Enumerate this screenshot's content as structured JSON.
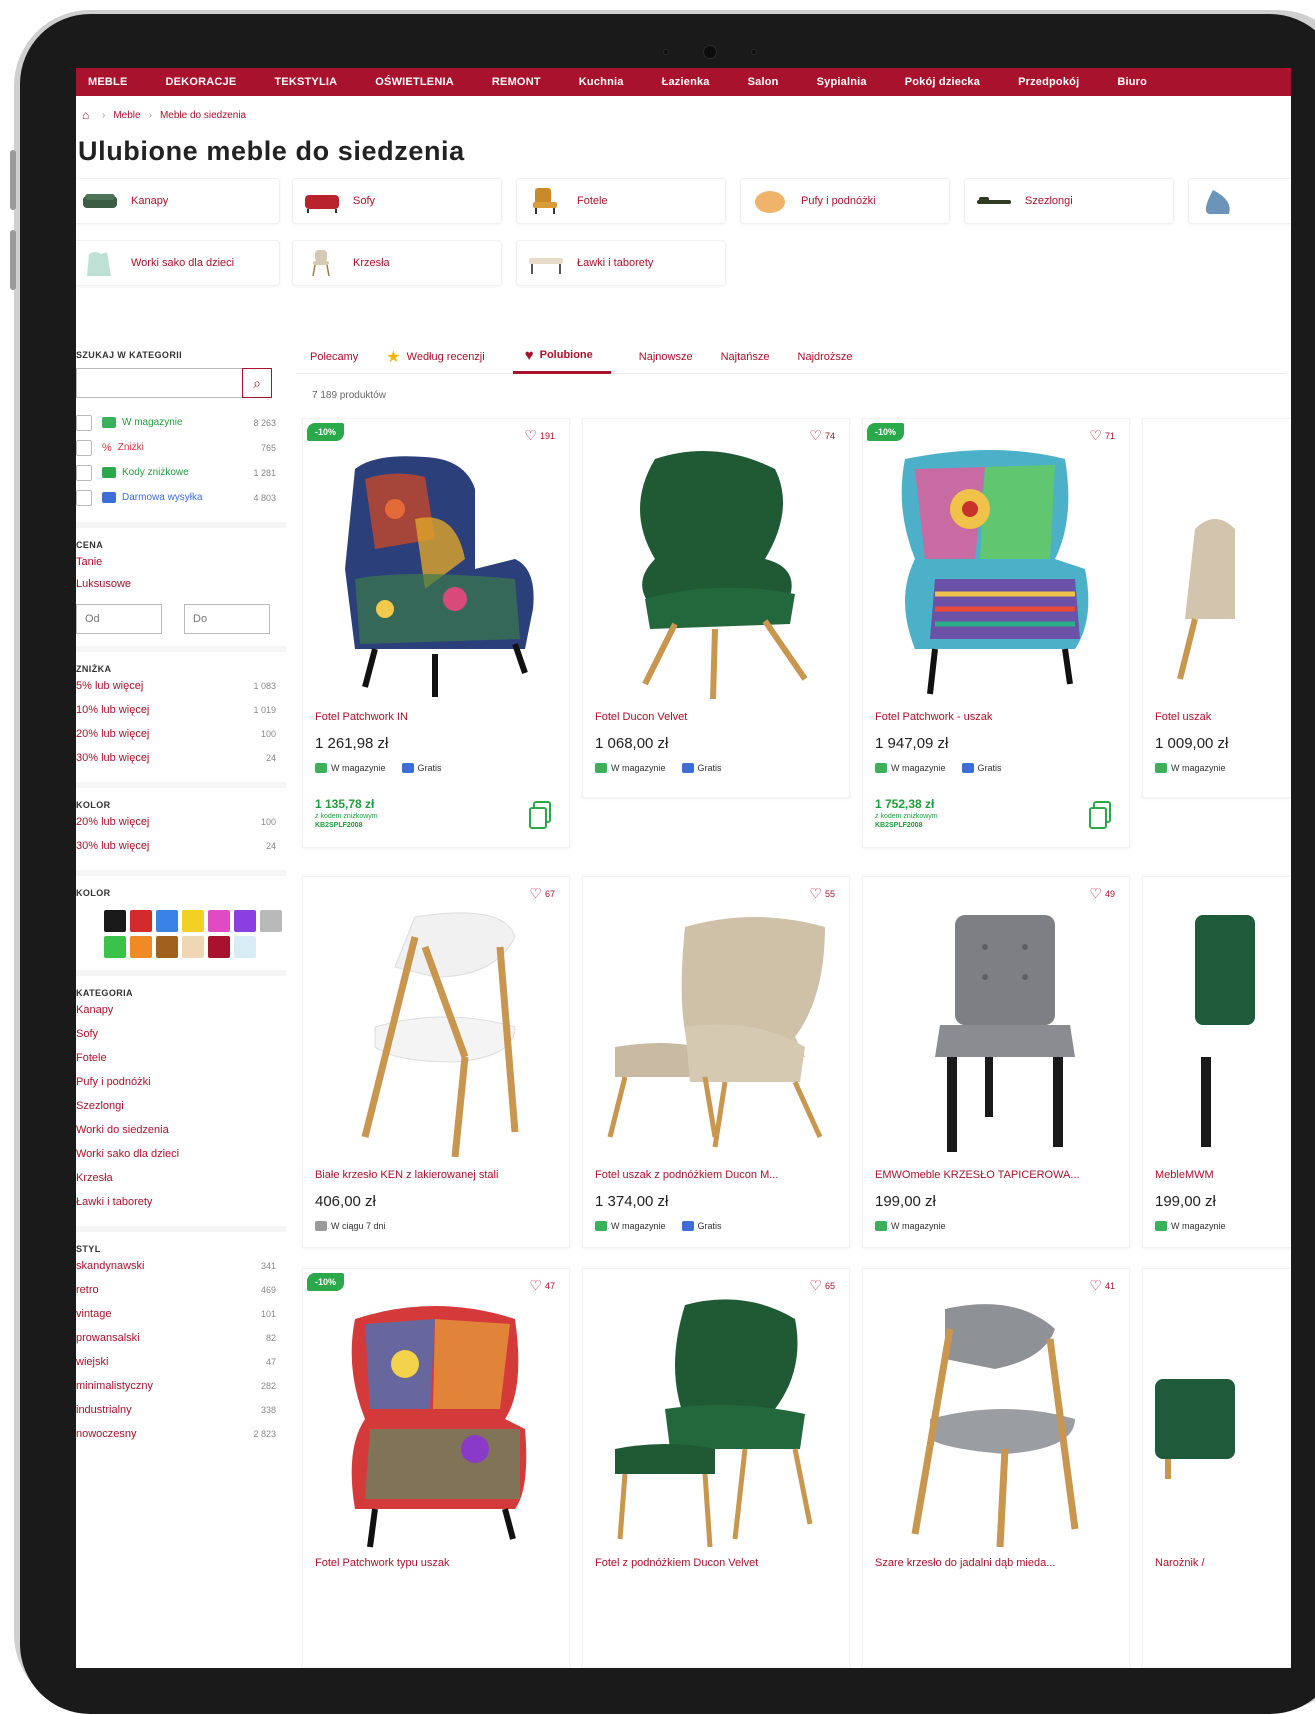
{
  "topnav": [
    "MEBLE",
    "DEKORACJE",
    "TEKSTYLIA",
    "OŚWIETLENIA",
    "REMONT",
    "Kuchnia",
    "Łazienka",
    "Salon",
    "Sypialnia",
    "Pokój dziecka",
    "Przedpokój",
    "Biuro"
  ],
  "breadcrumb": [
    "Meble",
    "Meble do siedzenia"
  ],
  "page_title": "Ulubione meble do siedzenia",
  "categories": [
    {
      "label": "Kanapy"
    },
    {
      "label": "Sofy"
    },
    {
      "label": "Fotele"
    },
    {
      "label": "Pufy i podnóżki"
    },
    {
      "label": "Szezlongi"
    },
    {
      "label": "Worki sako dla dzieci"
    },
    {
      "label": "Krzesła"
    },
    {
      "label": "Ławki i taborety"
    }
  ],
  "sidebar": {
    "search_label": "SZUKAJ W KATEGORII",
    "filters": [
      {
        "label": "W magazynie",
        "count": "8 263"
      },
      {
        "label": "Zniżki",
        "count": "765"
      },
      {
        "label": "Kody zniżkowe",
        "count": "1 281"
      },
      {
        "label": "Darmowa wysyłka",
        "count": "4 803"
      }
    ],
    "price_label": "CENA",
    "price_links": [
      "Tanie",
      "Luksusowe"
    ],
    "price_from": "Od",
    "price_to": "Do",
    "discount_label": "ZNIŻKA",
    "discounts": [
      {
        "label": "5% lub więcej",
        "count": "1 083"
      },
      {
        "label": "10% lub więcej",
        "count": "1 019"
      },
      {
        "label": "20% lub więcej",
        "count": "100"
      },
      {
        "label": "30% lub więcej",
        "count": "24"
      }
    ],
    "kolor1_label": "KOLOR",
    "kolor1": [
      {
        "label": "20% lub więcej",
        "count": "100"
      },
      {
        "label": "30% lub więcej",
        "count": "24"
      }
    ],
    "kolor2_label": "KOLOR",
    "swatch_colors": [
      "#1a1a1a",
      "#d42a2a",
      "#3b82e6",
      "#f2d024",
      "#e04bc4",
      "#8b3fe0",
      "#b9b9b9",
      "#3bc24a",
      "#f08a24",
      "#a0601e",
      "#efd6b4",
      "#a8122d",
      "#d7ecf4"
    ],
    "category_label": "KATEGORIA",
    "category_links": [
      "Kanapy",
      "Sofy",
      "Fotele",
      "Pufy i podnóżki",
      "Szezlongi",
      "Worki do siedzenia",
      "Worki sako dla dzieci",
      "Krzesła",
      "Ławki i taborety"
    ],
    "style_label": "STYL",
    "styles": [
      {
        "label": "skandynawski",
        "count": "341"
      },
      {
        "label": "retro",
        "count": "469"
      },
      {
        "label": "vintage",
        "count": "101"
      },
      {
        "label": "prowansalski",
        "count": "82"
      },
      {
        "label": "wiejski",
        "count": "47"
      },
      {
        "label": "minimalistyczny",
        "count": "282"
      },
      {
        "label": "industrialny",
        "count": "338"
      },
      {
        "label": "nowoczesny",
        "count": "2 823"
      }
    ]
  },
  "tabs": [
    "Polecamy",
    "Według recenzji",
    "Polubione",
    "Najnowsze",
    "Najtańsze",
    "Najdroższe"
  ],
  "product_count": "7 189 produktów",
  "products": [
    {
      "name": "Fotel Patchwork IN",
      "price": "1 261,98 zł",
      "likes": "191",
      "badge": "-10%",
      "tag1": "W magazynie",
      "tag2": "Gratis",
      "promo_price": "1 135,78 zł",
      "promo_note": "z kodem zniżkowym",
      "promo_code": "KB2SPLF2008"
    },
    {
      "name": "Fotel Ducon Velvet",
      "price": "1 068,00 zł",
      "likes": "74",
      "tag1": "W magazynie",
      "tag2": "Gratis"
    },
    {
      "name": "Fotel Patchwork - uszak",
      "price": "1 947,09 zł",
      "likes": "71",
      "badge": "-10%",
      "tag1": "W magazynie",
      "tag2": "Gratis",
      "promo_price": "1 752,38 zł",
      "promo_note": "z kodem zniżkowym",
      "promo_code": "KB2SPLF2008"
    },
    {
      "name": "Fotel uszak",
      "price": "1 009,00 zł",
      "tag1": "W magazynie"
    },
    {
      "name": "Białe krzesło KEN z lakierowanej stali",
      "price": "406,00 zł",
      "likes": "67",
      "tag1": "W ciągu 7 dni"
    },
    {
      "name": "Fotel uszak z podnóżkiem Ducon M...",
      "price": "1 374,00 zł",
      "likes": "55",
      "tag1": "W magazynie",
      "tag2": "Gratis"
    },
    {
      "name": "EMWOmeble KRZESŁO TAPICEROWA...",
      "price": "199,00 zł",
      "likes": "49",
      "tag1": "W magazynie"
    },
    {
      "name": "MebleMWM",
      "price": "199,00 zł",
      "tag1": "W magazynie"
    },
    {
      "name": "Fotel Patchwork typu uszak",
      "likes": "47",
      "badge": "-10%"
    },
    {
      "name": "Fotel z podnóżkiem Ducon Velvet",
      "likes": "65"
    },
    {
      "name": "Szare krzesło do jadalni dąb mieda...",
      "likes": "41"
    },
    {
      "name": "Narożnik /"
    }
  ]
}
